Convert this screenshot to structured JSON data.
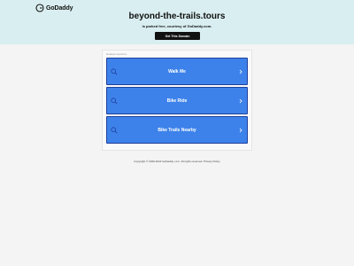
{
  "header": {
    "logo_text": "GoDaddy",
    "domain": "beyond-the-trails.tours",
    "parked_message": "is parked free, courtesy of GoDaddy.com.",
    "cta_label": "Get This Domain",
    "background_color": "#d9eef0"
  },
  "related": {
    "label": "Related searches",
    "items": [
      {
        "label": "Walk Me"
      },
      {
        "label": "Bike Ride"
      },
      {
        "label": "Bike Trails Nearby"
      }
    ],
    "button_color": "#3d82ea",
    "icons": [
      "search-icon",
      "chevron-right-icon"
    ]
  },
  "footer": {
    "copyright": "Copyright © 1999-2022 GoDaddy, LLC. All rights reserved.",
    "privacy_label": "Privacy Policy"
  }
}
